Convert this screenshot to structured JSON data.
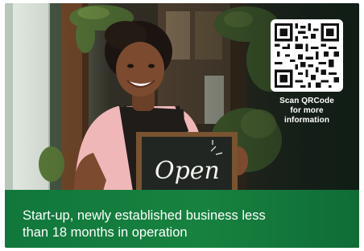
{
  "advert": {
    "qr_caption": [
      "Scan QRCode",
      "for more",
      "information"
    ],
    "headline": [
      "Start-up, newly established business less",
      "than 18 months in operation"
    ],
    "chalkboard_text": "Open"
  },
  "colors": {
    "band_green": "#17823f",
    "apron_black": "#1f1c1a",
    "shirt_pink": "#f0b7b8",
    "window_green": "#6a8a4a"
  },
  "icons": [
    "qr-code-icon"
  ]
}
